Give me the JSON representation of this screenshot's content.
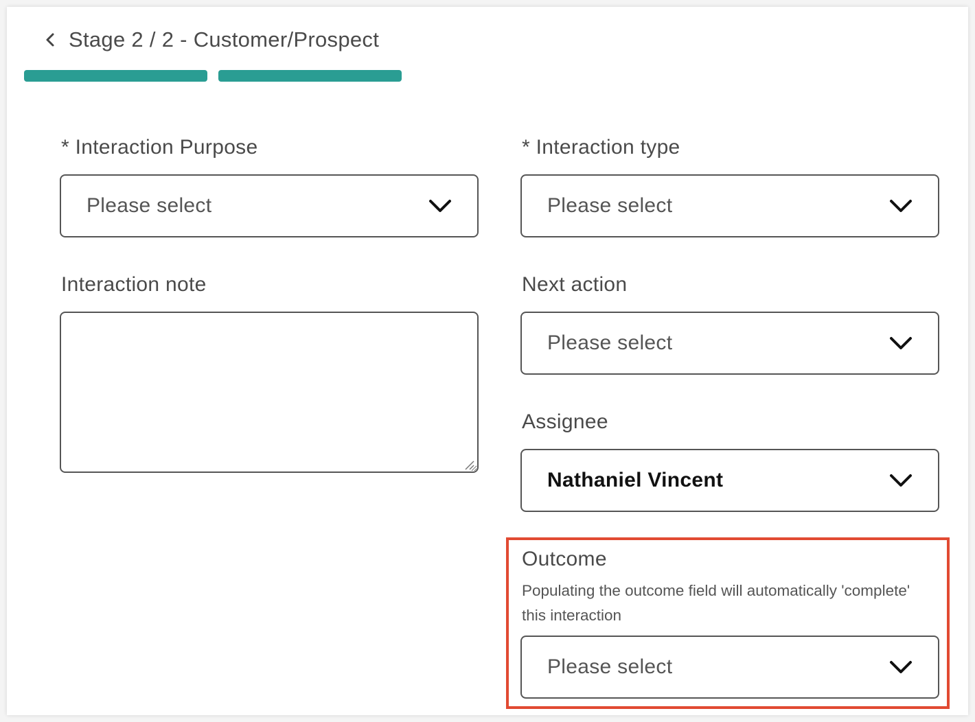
{
  "header": {
    "title": "Stage 2 / 2 - Customer/Prospect",
    "back_icon": "chevron-left-icon"
  },
  "progress": {
    "current_stage": 2,
    "total_stages": 2,
    "color": "#2a9d93"
  },
  "form": {
    "interaction_purpose": {
      "label": "* Interaction Purpose",
      "placeholder": "Please select"
    },
    "interaction_type": {
      "label": "* Interaction type",
      "placeholder": "Please select"
    },
    "interaction_note": {
      "label": "Interaction note",
      "value": ""
    },
    "next_action": {
      "label": "Next action",
      "placeholder": "Please select"
    },
    "assignee": {
      "label": "Assignee",
      "value": "Nathaniel Vincent"
    },
    "outcome": {
      "label": "Outcome",
      "helper": "Populating the outcome field will automatically 'complete' this interaction",
      "placeholder": "Please select"
    }
  },
  "icons": {
    "dropdown": "chevron-down-icon",
    "resize": "resize-handle-icon"
  },
  "colors": {
    "accent": "#2a9d93",
    "highlight": "#e14a32"
  }
}
